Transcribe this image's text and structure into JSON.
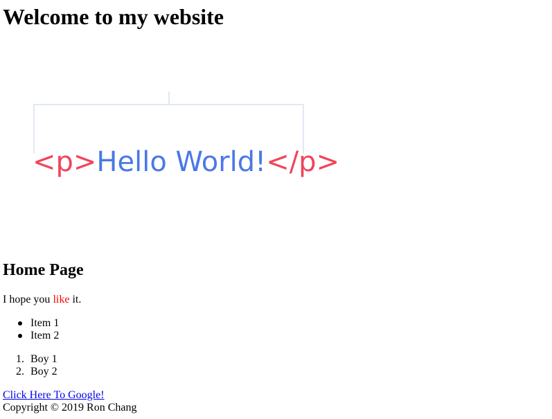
{
  "page": {
    "heading": "Welcome to my website",
    "hero_image": {
      "icon": "code-snippet-image",
      "open_tag": "<p>",
      "content": "Hello World!",
      "close_tag": "</p>",
      "tag_color": "#f0455a",
      "text_color": "#4a78e6"
    },
    "section_title": "Home Page",
    "intro": {
      "before": "I hope you ",
      "highlight": "like",
      "after": " it.",
      "highlight_color": "#ff0000"
    },
    "unordered_list": [
      "Item 1",
      "Item 2"
    ],
    "ordered_list": {
      "numbers": [
        "1.",
        "2."
      ],
      "items": [
        "Boy 1",
        "Boy 2"
      ]
    },
    "link_text": "Click Here To Google!",
    "copyright": "Copyright © 2019 Ron Chang"
  }
}
